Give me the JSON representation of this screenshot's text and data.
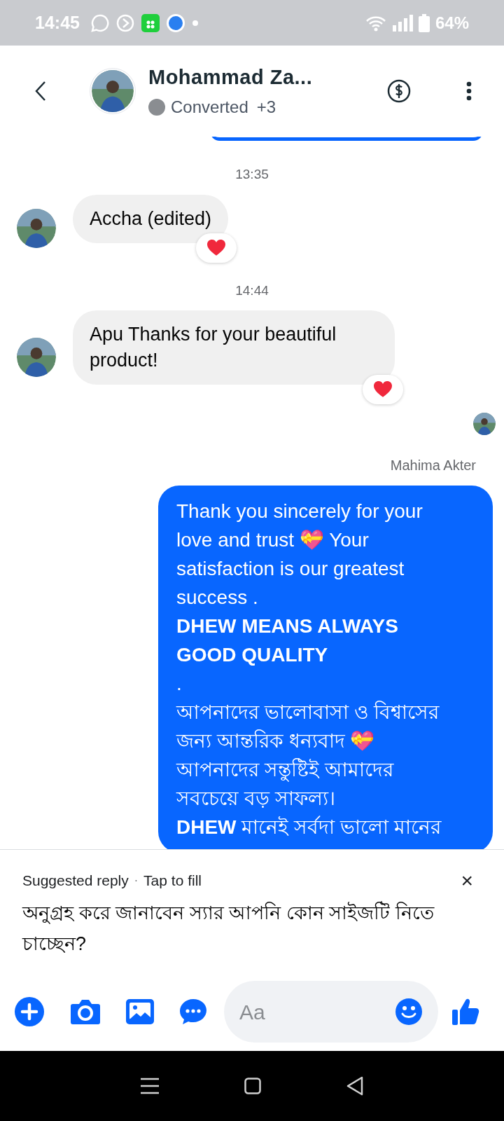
{
  "status_bar": {
    "time": "14:45",
    "battery": "64%"
  },
  "header": {
    "name": "Mohammad Za...",
    "status": "Converted",
    "extra": "+3"
  },
  "messages": [
    {
      "kind": "time",
      "text": "13:35"
    },
    {
      "kind": "received",
      "text": "Accha (edited)",
      "reacted": true
    },
    {
      "kind": "time",
      "text": "14:44"
    },
    {
      "kind": "received",
      "text": "Apu Thanks for your beautiful product!",
      "reacted": true
    },
    {
      "kind": "seen"
    },
    {
      "kind": "sender",
      "text": "Mahima Akter"
    },
    {
      "kind": "sent",
      "text": "Thank you sincerely for your love and trust 💝 Your satisfaction is our greatest success .\n**DHEW MEANS ALWAYS GOOD QUALITY**\n.\nআপনাদের ভালোবাসা ও বিশ্বাসের জন্য আন্তরিক ধন্যবাদ 💝\nআপনাদের সন্তুষ্টিই আমাদের সবচেয়ে বড় সাফল্য।\n**DHEW** মানেই সর্বদা ভালো মানের"
    }
  ],
  "suggestion": {
    "label": "Suggested reply",
    "separator": "·",
    "hint": "Tap to fill",
    "close": "×",
    "text": "অনুগ্রহ করে জানাবেন স্যার আপনি কোন সাইজটি নিতে চাচ্ছেন?"
  },
  "composer": {
    "placeholder": "Aa"
  }
}
